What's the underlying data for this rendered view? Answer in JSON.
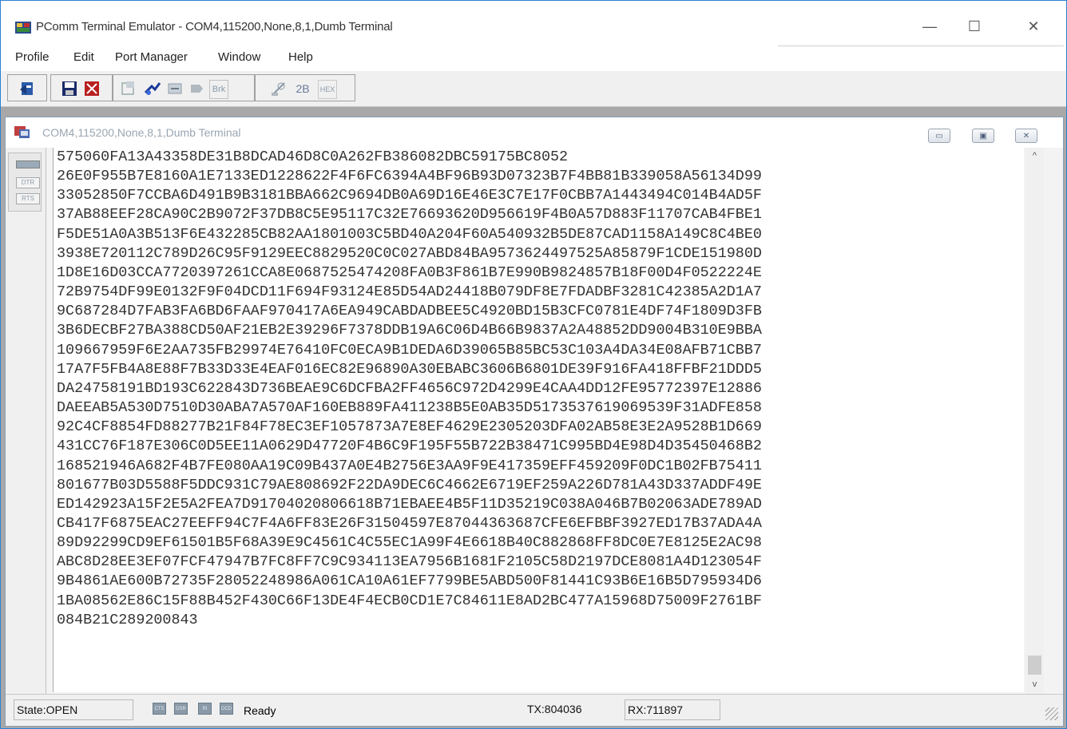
{
  "window": {
    "title": "PComm Terminal Emulator - COM4,115200,None,8,1,Dumb Terminal",
    "minimize": "—",
    "maximize": "☐",
    "close": "✕"
  },
  "menu": [
    "Profile",
    "Edit",
    "Port Manager",
    "Window",
    "Help"
  ],
  "toolbar": {
    "icons": [
      "open-profile-icon",
      "save-icon",
      "exit-icon",
      "properties-icon",
      "connect-icon",
      "disconnect-icon",
      "send-file-icon",
      "break-icon",
      "transfer-icon",
      "2b-icon",
      "hex-icon"
    ],
    "brk_label": "Brk",
    "twob_label": "2B",
    "hex_label": "HEX"
  },
  "child": {
    "title": "COM4,115200,None,8,1,Dumb Terminal",
    "side": {
      "dtr": "DTR",
      "rts": "RTS"
    }
  },
  "terminal_lines": [
    "575060FA13A43358DE31B8DCAD46D8C0A262FB386082DBC59175BC8052",
    "26E0F955B7E8160A1E7133ED1228622F4F6FC6394A4BF96B93D07323B7F4BB81B339058A56134D99",
    "33052850F7CCBA6D491B9B3181BBA662C9694DB0A69D16E46E3C7E17F0CBB7A1443494C014B4AD5F",
    "37AB88EEF28CA90C2B9072F37DB8C5E95117C32E76693620D956619F4B0A57D883F11707CAB4FBE1",
    "F5DE51A0A3B513F6E432285CB82AA1801003C5BD40A204F60A540932B5DE87CAD1158A149C8C4BE0",
    "3938E720112C789D26C95F9129EEC8829520C0C027ABD84BA9573624497525A85879F1CDE151980D",
    "1D8E16D03CCA7720397261CCA8E0687525474208FA0B3F861B7E990B9824857B18F00D4F0522224E",
    "72B9754DF99E0132F9F04DCD11F694F93124E85D54AD24418B079DF8E7FDADBF3281C42385A2D1A7",
    "9C687284D7FAB3FA6BD6FAAF970417A6EA949CABDADBEE5C4920BD15B3CFC0781E4DF74F1809D3FB",
    "3B6DECBF27BA388CD50AF21EB2E39296F7378DDB19A6C06D4B66B9837A2A48852DD9004B310E9BBA",
    "109667959F6E2AA735FB29974E76410FC0ECA9B1DEDA6D39065B85BC53C103A4DA34E08AFB71CBB7",
    "17A7F5FB4A8E88F7B33D33E4EAF016EC82E96890A30EBABC3606B6801DE39F916FA418FFBF21DDD5",
    "DA24758191BD193C622843D736BEAE9C6DCFBA2FF4656C972D4299E4CAA4DD12FE95772397E12886",
    "DAEEAB5A530D7510D30ABA7A570AF160EB889FA411238B5E0AB35D5173537619069539F31ADFE858",
    "92C4CF8854FD88277B21F84F78EC3EF1057873A7E8EF4629E2305203DFA02AB58E3E2A9528B1D669",
    "431CC76F187E306C0D5EE11A0629D47720F4B6C9F195F55B722B38471C995BD4E98D4D35450468B2",
    "168521946A682F4B7FE080AA19C09B437A0E4B2756E3AA9F9E417359EFF459209F0DC1B02FB75411",
    "801677B03D5588F5DDC931C79AE808692F22DA9DEC6C4662E6719EF259A226D781A43D337ADDF49E",
    "ED142923A15F2E5A2FEA7D91704020806618B71EBAEE4B5F11D35219C038A046B7B02063ADE789AD",
    "CB417F6875EAC27EEFF94C7F4A6FF83E26F31504597E87044363687CFE6EFBBF3927ED17B37ADA4A",
    "89D92299CD9EF61501B5F68A39E9C4561C4C55EC1A99F4E6618B40C882868FF8DC0E7E8125E2AC98",
    "ABC8D28EE3EF07FCF47947B7FC8FF7C9C934113EA7956B1681F2105C58D2197DCE8081A4D123054F",
    "9B4861AE600B72735F28052248986A061CA10A61EF7799BE5ABD500F81441C93B6E16B5D795934D6",
    "1BA08562E86C15F88B452F430C66F13DE4F4ECB0CD1E7C84611E8AD2BC477A15968D75009F2761BF",
    "084B21C289200843"
  ],
  "status": {
    "state": "State:OPEN",
    "leds": [
      "CTS",
      "DSR",
      "RI",
      "DCD"
    ],
    "ready": "Ready",
    "tx": "TX:804036",
    "rx": "RX:711897"
  }
}
